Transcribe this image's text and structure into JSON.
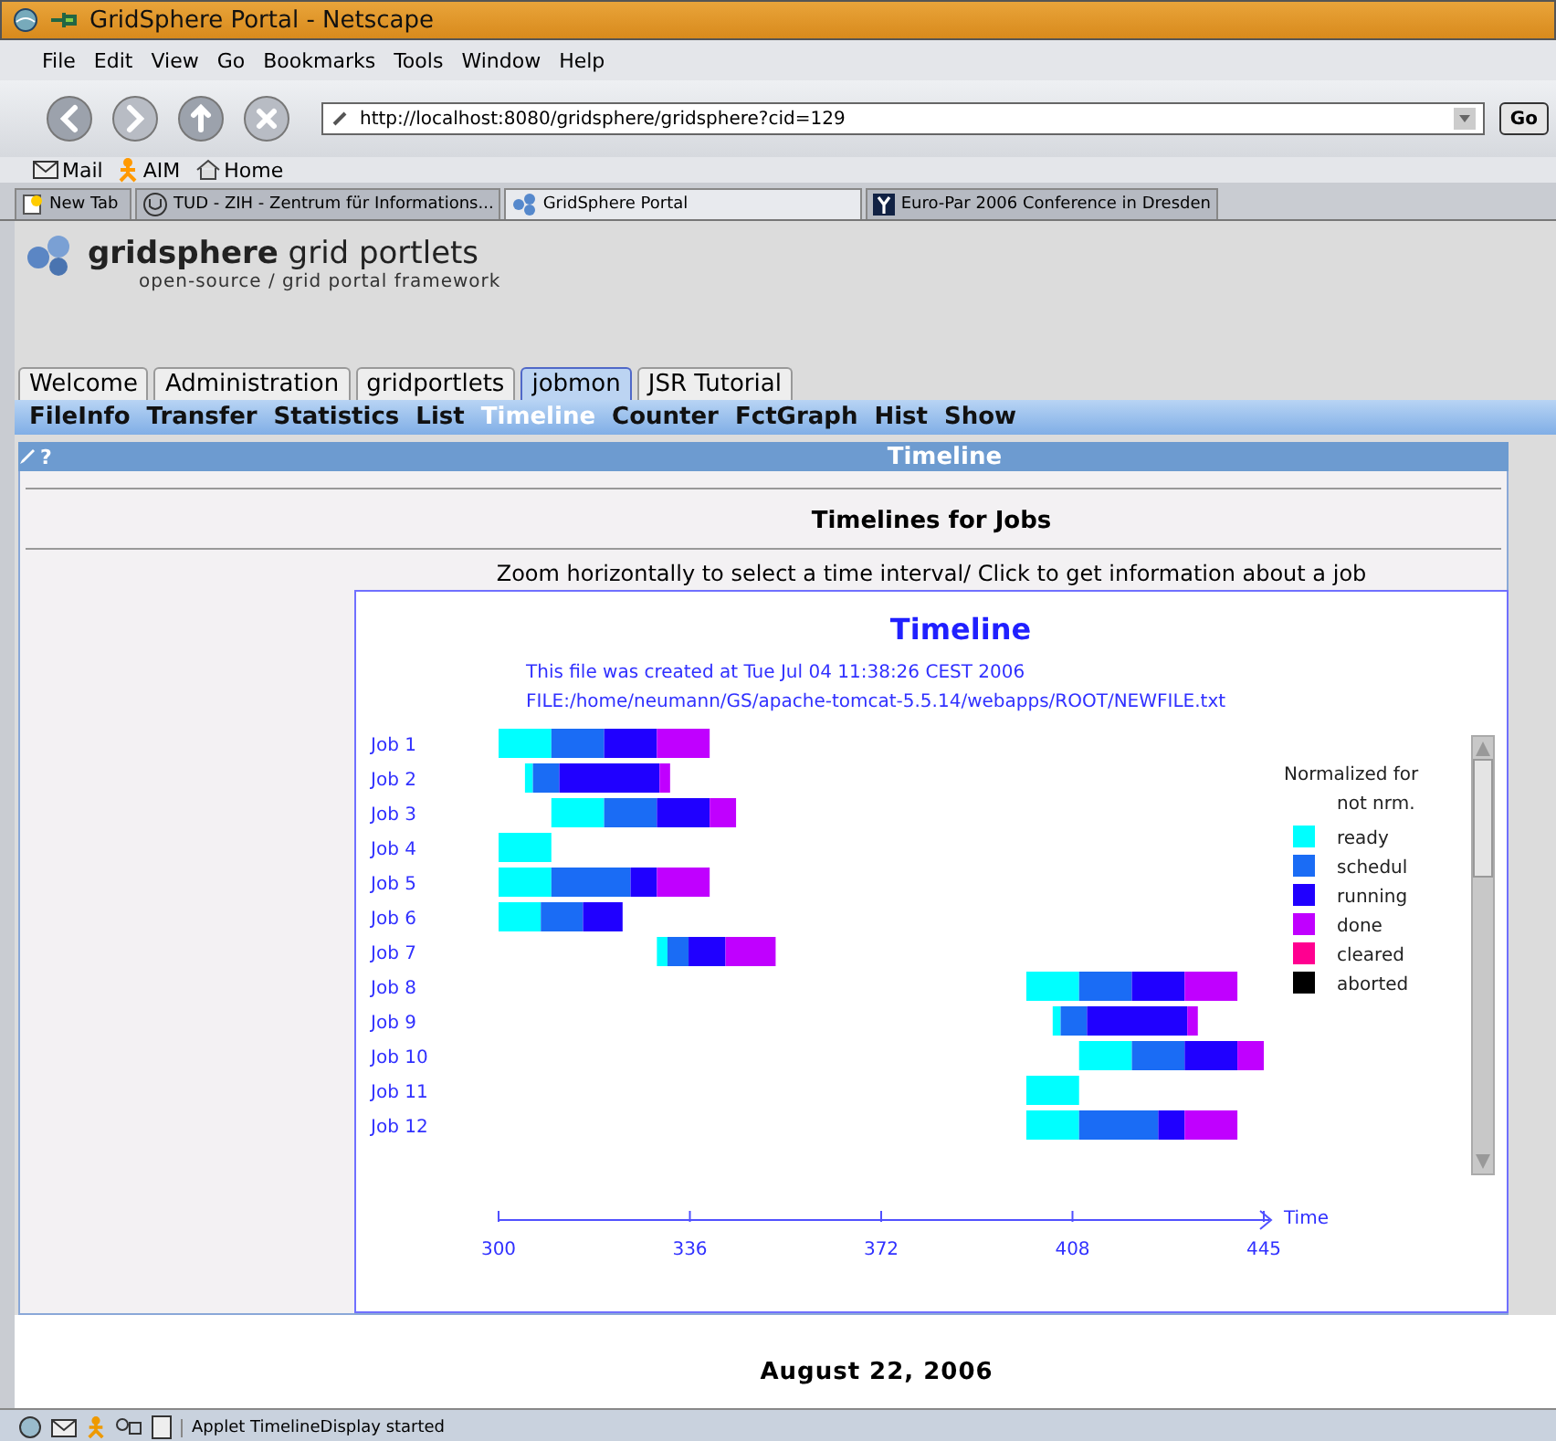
{
  "window": {
    "title": "GridSphere Portal - Netscape"
  },
  "menu": [
    "File",
    "Edit",
    "View",
    "Go",
    "Bookmarks",
    "Tools",
    "Window",
    "Help"
  ],
  "address_bar": {
    "value": "http://localhost:8080/gridsphere/gridsphere?cid=129",
    "go_button": "Go"
  },
  "personal_toolbar": [
    "Mail",
    "AIM",
    "Home"
  ],
  "browser_tabs": [
    {
      "label": "New Tab",
      "selected": false
    },
    {
      "label": "TUD - ZIH - Zentrum für Informations...",
      "selected": false
    },
    {
      "label": "GridSphere Portal",
      "selected": true
    },
    {
      "label": "Euro-Par 2006 Conference in Dresden",
      "selected": false
    }
  ],
  "logo": {
    "title": "**gridsphere** grid portlets",
    "subtitle": "open-source / grid portal framework"
  },
  "portal_tabs": [
    {
      "label": "Welcome",
      "selected": false
    },
    {
      "label": "Administration",
      "selected": false
    },
    {
      "label": "gridportlets",
      "selected": false
    },
    {
      "label": "jobmon",
      "selected": true
    },
    {
      "label": "JSR Tutorial",
      "selected": false
    }
  ],
  "sub_tabs": [
    {
      "label": "FileInfo",
      "selected": false
    },
    {
      "label": "Transfer",
      "selected": false
    },
    {
      "label": "Statistics",
      "selected": false
    },
    {
      "label": "List",
      "selected": false
    },
    {
      "label": "Timeline",
      "selected": true
    },
    {
      "label": "Counter",
      "selected": false
    },
    {
      "label": "FctGraph",
      "selected": false
    },
    {
      "label": "Hist",
      "selected": false
    },
    {
      "label": "Show",
      "selected": false
    }
  ],
  "portlet": {
    "title": "Timeline",
    "help": "?",
    "heading": "Timelines for Jobs",
    "instruction": "Zoom horizontally to select a time interval/ Click to get information about a job",
    "applet": {
      "title": "Timeline",
      "created": "This file was created at Tue Jul 04 11:38:26 CEST 2006",
      "file": "FILE:/home/neumann/GS/apache-tomcat-5.5.14/webapps/ROOT/NEWFILE.txt",
      "jobs": [
        "Job 1",
        "Job 2",
        "Job 3",
        "Job 4",
        "Job 5",
        "Job 6",
        "Job 7",
        "Job 8",
        "Job 9",
        "Job 10",
        "Job 11",
        "Job 12"
      ],
      "legend_title": "Normalized for",
      "legend_subtitle": "not nrm.",
      "legend": [
        {
          "label": "ready",
          "color": "#00ffff"
        },
        {
          "label": "schedul",
          "color": "#1a6cf5"
        },
        {
          "label": "running",
          "color": "#2000ff"
        },
        {
          "label": "done",
          "color": "#c000ff"
        },
        {
          "label": "cleared",
          "color": "#ff0090"
        },
        {
          "label": "aborted",
          "color": "#000000"
        }
      ],
      "axis_label": "Time",
      "axis_ticks": [
        "300",
        "336",
        "372",
        "408",
        "445"
      ]
    }
  },
  "footer": {
    "date": "August 22, 2006"
  },
  "status_bar": {
    "text": "Applet TimelineDisplay started"
  }
}
